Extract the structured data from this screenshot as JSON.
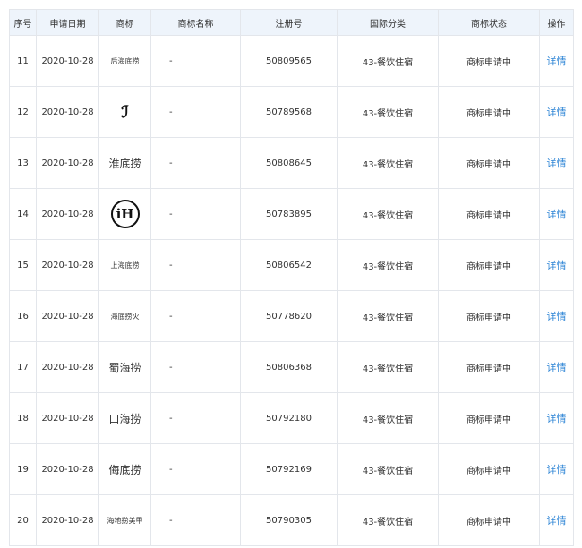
{
  "header": {
    "index": "序号",
    "date": "申请日期",
    "mark": "商标",
    "name": "商标名称",
    "reg": "注册号",
    "class": "国际分类",
    "status": "商标状态",
    "action": "操作"
  },
  "rows": [
    {
      "index": "11",
      "date": "2020-10-28",
      "logo": "后海底捞",
      "logo_style": "small",
      "name": "-",
      "reg": "50809565",
      "class": "43-餐饮住宿",
      "status": "商标申请中",
      "action": "详情"
    },
    {
      "index": "12",
      "date": "2020-10-28",
      "logo": "ℐ",
      "logo_style": "swirl",
      "name": "-",
      "reg": "50789568",
      "class": "43-餐饮住宿",
      "status": "商标申请中",
      "action": "详情"
    },
    {
      "index": "13",
      "date": "2020-10-28",
      "logo": "淮底捞",
      "logo_style": "large",
      "name": "-",
      "reg": "50808645",
      "class": "43-餐饮住宿",
      "status": "商标申请中",
      "action": "详情"
    },
    {
      "index": "14",
      "date": "2020-10-28",
      "logo": "iH",
      "logo_style": "circle",
      "name": "-",
      "reg": "50783895",
      "class": "43-餐饮住宿",
      "status": "商标申请中",
      "action": "详情"
    },
    {
      "index": "15",
      "date": "2020-10-28",
      "logo": "上海底捞",
      "logo_style": "small",
      "name": "-",
      "reg": "50806542",
      "class": "43-餐饮住宿",
      "status": "商标申请中",
      "action": "详情"
    },
    {
      "index": "16",
      "date": "2020-10-28",
      "logo": "海底捞火",
      "logo_style": "small",
      "name": "-",
      "reg": "50778620",
      "class": "43-餐饮住宿",
      "status": "商标申请中",
      "action": "详情"
    },
    {
      "index": "17",
      "date": "2020-10-28",
      "logo": "蜀海捞",
      "logo_style": "large",
      "name": "-",
      "reg": "50806368",
      "class": "43-餐饮住宿",
      "status": "商标申请中",
      "action": "详情"
    },
    {
      "index": "18",
      "date": "2020-10-28",
      "logo": "口海捞",
      "logo_style": "large",
      "name": "-",
      "reg": "50792180",
      "class": "43-餐饮住宿",
      "status": "商标申请中",
      "action": "详情"
    },
    {
      "index": "19",
      "date": "2020-10-28",
      "logo": "侮底捞",
      "logo_style": "large",
      "name": "-",
      "reg": "50792169",
      "class": "43-餐饮住宿",
      "status": "商标申请中",
      "action": "详情"
    },
    {
      "index": "20",
      "date": "2020-10-28",
      "logo": "海地捞美甲",
      "logo_style": "small",
      "name": "-",
      "reg": "50790305",
      "class": "43-餐饮住宿",
      "status": "商标申请中",
      "action": "详情"
    }
  ]
}
